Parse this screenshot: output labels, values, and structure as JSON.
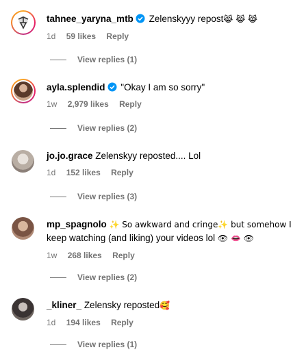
{
  "comments": [
    {
      "username": "tahnee_yaryna_mtb",
      "verified": true,
      "text": "Zelenskyyy repost",
      "emojis": "😹 😹 😹",
      "time": "1d",
      "likes": "59 likes",
      "reply": "Reply",
      "view_replies": "View replies (1)"
    },
    {
      "username": "ayla.splendid",
      "verified": true,
      "text": "\"Okay I am so sorry\"",
      "time": "1w",
      "likes": "2,979 likes",
      "reply": "Reply",
      "view_replies": "View replies (2)"
    },
    {
      "username": "jo.jo.grace",
      "verified": false,
      "text": "Zelenskyy reposted.... Lol",
      "time": "1d",
      "likes": "152 likes",
      "reply": "Reply",
      "view_replies": "View replies (3)"
    },
    {
      "username": "mp_spagnolo",
      "verified": false,
      "text_line1_a": "✨ So awkward and cringe",
      "text_line1_b": "✨ but somehow I",
      "text_line2": "keep watching (and liking) your videos lol",
      "emojis_line2": "👁 👄 👁",
      "time": "1w",
      "likes": "268 likes",
      "reply": "Reply",
      "view_replies": "View replies (2)"
    },
    {
      "username": "_kliner_",
      "verified": false,
      "text": "Zelensky reposted",
      "emojis": "🥰",
      "time": "1d",
      "likes": "194 likes",
      "reply": "Reply",
      "view_replies": "View replies (1)"
    }
  ],
  "colors": {
    "verified": "#0095f6",
    "muted": "#737373"
  }
}
